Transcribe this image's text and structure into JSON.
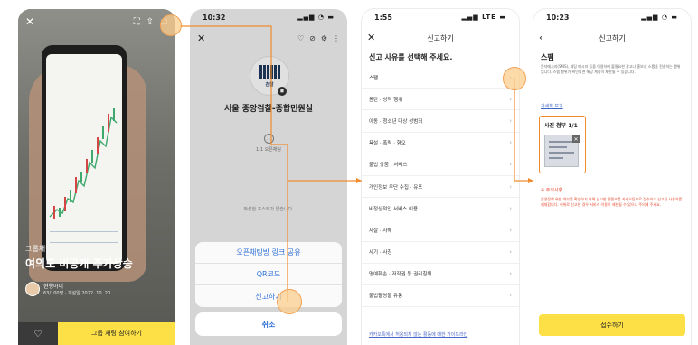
{
  "screen1": {
    "hero_tag": "그룹채팅",
    "hero_title": "여의도 비공개 주가상승",
    "owner_name": "현행아이",
    "meta": "63/100명 · 개설일 2022. 10. 20.",
    "join_button": "그룹 채팅 참여하기",
    "heart_icon": "heart-icon",
    "close_icon": "close-icon",
    "accent": "#fde046"
  },
  "screen2": {
    "time": "10:32",
    "room_name": "서울 중앙검찰-종합민원실",
    "chat_badge_label": "1:1 오픈채팅",
    "empty_message": "작성한 포스트가 없습니다.",
    "logo_text": "검찰",
    "actions": [
      {
        "label": "오픈채팅방 링크 공유"
      },
      {
        "label": "QR코드"
      },
      {
        "label": "신고하기"
      }
    ],
    "cancel": "취소",
    "action_color": "#2c6fd6"
  },
  "screen3": {
    "time": "1:55",
    "title": "신고하기",
    "prompt": "신고 사유를 선택해 주세요.",
    "reasons": [
      {
        "label": "스팸"
      },
      {
        "label": "음란 · 성적 행위"
      },
      {
        "label": "아동 · 청소년 대상 성범죄"
      },
      {
        "label": "욕설 · 폭력 · 혐오"
      },
      {
        "label": "불법 상품 · 서비스"
      },
      {
        "label": "개인정보 무단 수집 · 유포"
      },
      {
        "label": "비정상적인 서비스 이용"
      },
      {
        "label": "자살 · 자해"
      },
      {
        "label": "사기 · 사칭"
      },
      {
        "label": "명예훼손 · 저작권 등 권리침해"
      },
      {
        "label": "불법촬영물 유통"
      }
    ],
    "footer_link": "카카오톡에서 허용되지 않는 활동에 대한 가이드라인"
  },
  "screen4": {
    "time": "10:23",
    "title": "신고하기",
    "reason": "스팸",
    "description": "문자메시지(SMS), 채팅 메시지 등을 이용하여 불필요한 광고나 홍보성 스팸을 전송하는 행위입니다. 스팸 행위가 확인되면 해당 계정이 제한될 수 있습니다.",
    "guide_link": "자세히 보기",
    "attachment_label": "사진 첨부 1/1",
    "notice_title": "※ 주의사항",
    "notice_body": "운영정책 위반 여부를 확인하기 위해 신고한 콘텐츠를 카카오팀으로 접수하고 신고된 사용자를 제재합니다. 허위로 신고한 경우 서비스 이용이 제한될 수 있으니 주의해 주세요.",
    "submit": "접수하기",
    "warning_color": "#e54c32"
  },
  "annotation_color": "#f08c2e"
}
